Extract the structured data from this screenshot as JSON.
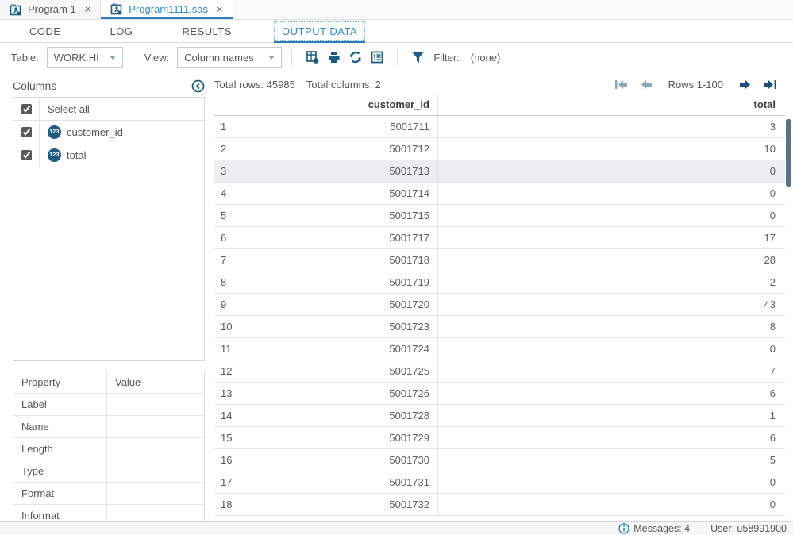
{
  "file_tabs": [
    {
      "label": "Program 1",
      "active": false
    },
    {
      "label": "Program1111.sas",
      "active": true
    }
  ],
  "close_glyph": "×",
  "nav_tabs": [
    {
      "label": "CODE",
      "active": false
    },
    {
      "label": "LOG",
      "active": false
    },
    {
      "label": "RESULTS",
      "active": false
    },
    {
      "label": "OUTPUT DATA",
      "active": true
    }
  ],
  "toolbar": {
    "table_label": "Table:",
    "table_value": "WORK.HI",
    "view_label": "View:",
    "view_value": "Column names",
    "filter_label": "Filter:",
    "filter_value": "(none)"
  },
  "columns_panel": {
    "title": "Columns",
    "select_all_label": "Select all",
    "badge_text": "123",
    "items": [
      {
        "name": "customer_id",
        "checked": true
      },
      {
        "name": "total",
        "checked": true
      }
    ]
  },
  "properties_panel": {
    "headers": [
      "Property",
      "Value"
    ],
    "rows": [
      {
        "property": "Label",
        "value": ""
      },
      {
        "property": "Name",
        "value": ""
      },
      {
        "property": "Length",
        "value": ""
      },
      {
        "property": "Type",
        "value": ""
      },
      {
        "property": "Format",
        "value": ""
      },
      {
        "property": "Informat",
        "value": ""
      }
    ]
  },
  "grid": {
    "total_rows_label": "Total rows: 45985",
    "total_columns_label": "Total columns: 2",
    "pagination_label": "Rows 1-100",
    "column_headers": [
      "customer_id",
      "total"
    ],
    "highlighted_row_index": 2,
    "rows": [
      {
        "n": "1",
        "customer_id": "5001711",
        "total": "3"
      },
      {
        "n": "2",
        "customer_id": "5001712",
        "total": "10"
      },
      {
        "n": "3",
        "customer_id": "5001713",
        "total": "0"
      },
      {
        "n": "4",
        "customer_id": "5001714",
        "total": "0"
      },
      {
        "n": "5",
        "customer_id": "5001715",
        "total": "0"
      },
      {
        "n": "6",
        "customer_id": "5001717",
        "total": "17"
      },
      {
        "n": "7",
        "customer_id": "5001718",
        "total": "28"
      },
      {
        "n": "8",
        "customer_id": "5001719",
        "total": "2"
      },
      {
        "n": "9",
        "customer_id": "5001720",
        "total": "43"
      },
      {
        "n": "10",
        "customer_id": "5001723",
        "total": "8"
      },
      {
        "n": "11",
        "customer_id": "5001724",
        "total": "0"
      },
      {
        "n": "12",
        "customer_id": "5001725",
        "total": "7"
      },
      {
        "n": "13",
        "customer_id": "5001726",
        "total": "6"
      },
      {
        "n": "14",
        "customer_id": "5001728",
        "total": "1"
      },
      {
        "n": "15",
        "customer_id": "5001729",
        "total": "6"
      },
      {
        "n": "16",
        "customer_id": "5001730",
        "total": "5"
      },
      {
        "n": "17",
        "customer_id": "5001731",
        "total": "0"
      },
      {
        "n": "18",
        "customer_id": "5001732",
        "total": "0"
      }
    ]
  },
  "status_bar": {
    "messages_label": "Messages: 4",
    "user_label": "User: u58991900"
  },
  "colors": {
    "accent_blue": "#2e8ccb",
    "underline_blue": "#2d7bb9",
    "icon_navy": "#1d5b82",
    "pager_enabled": "#1d4e79",
    "pager_disabled": "#8ca6bd",
    "text_gray": "#54585a",
    "row_highlight": "#ebedee",
    "scrollbar_thumb": "#5d7186"
  }
}
